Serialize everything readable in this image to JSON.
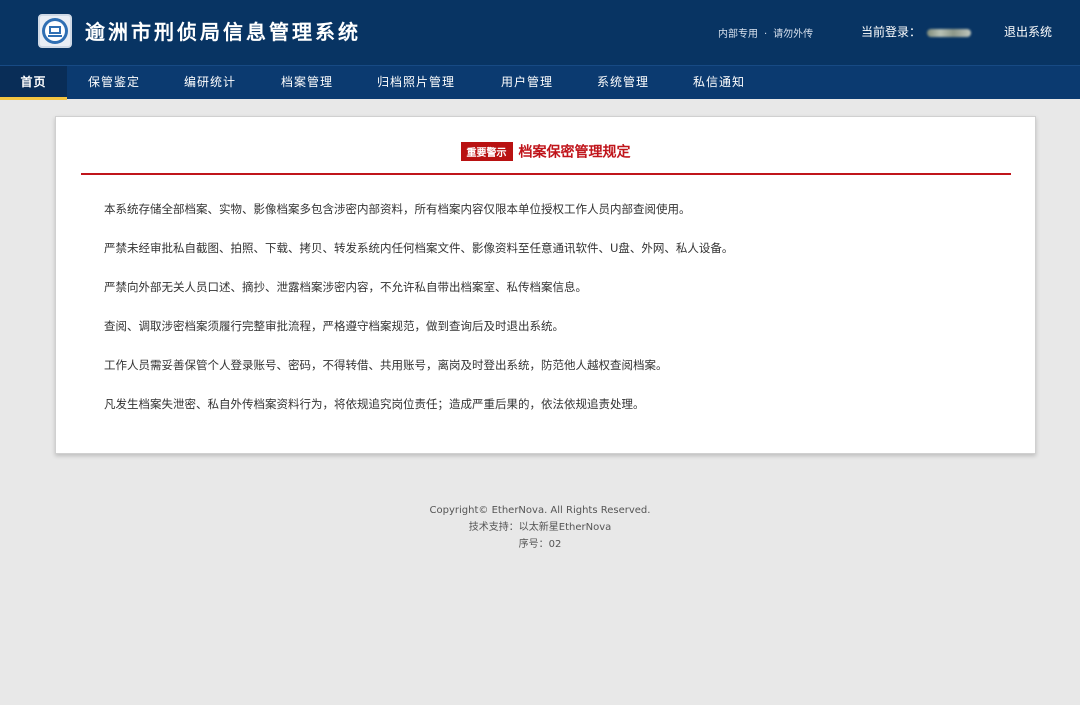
{
  "header": {
    "title": "逾洲市刑侦局信息管理系统",
    "notice_left": "内部专用",
    "notice_sep": "·",
    "notice_right": "请勿外传",
    "login_label": "当前登录：",
    "logout_label": "退出系统"
  },
  "nav": {
    "items": [
      {
        "label": "首页"
      },
      {
        "label": "保管鉴定"
      },
      {
        "label": "编研统计"
      },
      {
        "label": "档案管理"
      },
      {
        "label": "归档照片管理"
      },
      {
        "label": "用户管理"
      },
      {
        "label": "系统管理"
      },
      {
        "label": "私信通知"
      }
    ]
  },
  "panel": {
    "badge": "重要警示",
    "title": "档案保密管理规定",
    "paragraphs": [
      "本系统存储全部档案、实物、影像档案多包含涉密内部资料，所有档案内容仅限本单位授权工作人员内部查阅使用。",
      "严禁未经审批私自截图、拍照、下载、拷贝、转发系统内任何档案文件、影像资料至任意通讯软件、U盘、外网、私人设备。",
      "严禁向外部无关人员口述、摘抄、泄露档案涉密内容，不允许私自带出档案室、私传档案信息。",
      "查阅、调取涉密档案须履行完整审批流程，严格遵守档案规范，做到查询后及时退出系统。",
      "工作人员需妥善保管个人登录账号、密码，不得转借、共用账号，离岗及时登出系统，防范他人越权查阅档案。",
      "凡发生档案失泄密、私自外传档案资料行为，将依规追究岗位责任；造成严重后果的，依法依规追责处理。"
    ]
  },
  "footer": {
    "copyright": "Copyright© EtherNova. All Rights Reserved.",
    "support": "技术支持：以太新星EtherNova",
    "serial": "序号：02"
  },
  "colors": {
    "header_bg": "#083463",
    "accent_red": "#c0151b",
    "active_underline": "#f4c542"
  },
  "icons": {
    "logo": "bureau-emblem-icon"
  }
}
